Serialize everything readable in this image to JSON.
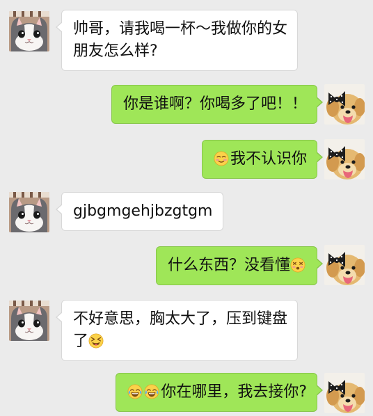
{
  "messages": [
    {
      "sender": "incoming",
      "lines": [
        "帅哥，请我喝一杯～我做你的女",
        "朋友怎么样?"
      ]
    },
    {
      "sender": "outgoing",
      "text": "你是谁啊？你喝多了吧！！"
    },
    {
      "sender": "outgoing",
      "emoji": "blushing-smile-emoji",
      "text": "我不认识你"
    },
    {
      "sender": "incoming",
      "text": "gjbgmgehjbzgtgm"
    },
    {
      "sender": "outgoing",
      "text": "什么东西？没看懂",
      "emoji_after": "dizzy-face-emoji"
    },
    {
      "sender": "incoming",
      "lines": [
        "不好意思，胸太大了，压到键盘",
        "了"
      ],
      "emoji_after": "tongue-out-wink-emoji"
    },
    {
      "sender": "outgoing",
      "emojis": [
        "tears-of-joy-emoji",
        "tears-of-joy-emoji"
      ],
      "text": "你在哪里，我去接你?"
    }
  ],
  "avatars": {
    "incoming": "cat-avatar",
    "outgoing": "dog-with-bow-avatar"
  },
  "colors": {
    "background": "#ebebeb",
    "incoming_bubble": "#ffffff",
    "outgoing_bubble": "#9fe658"
  }
}
